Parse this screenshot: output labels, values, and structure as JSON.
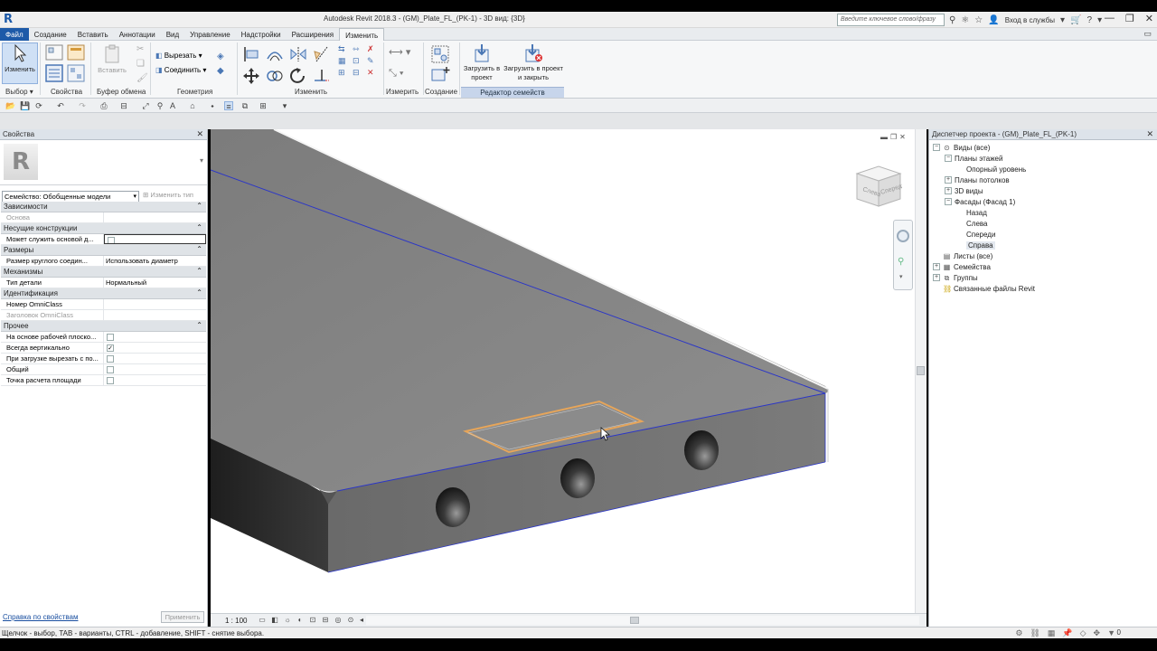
{
  "app": {
    "title": "Autodesk Revit 2018.3 -    (GM)_Plate_FL_(PK-1) - 3D вид: {3D}",
    "search_placeholder": "Введите ключевое слово/фразу",
    "sign_in": "Вход в службы"
  },
  "tabs": [
    {
      "label": "Файл"
    },
    {
      "label": "Создание"
    },
    {
      "label": "Вставить"
    },
    {
      "label": "Аннотации"
    },
    {
      "label": "Вид"
    },
    {
      "label": "Управление"
    },
    {
      "label": "Надстройки"
    },
    {
      "label": "Расширения"
    },
    {
      "label": "Изменить"
    }
  ],
  "ribbon": {
    "modify_label": "Изменить",
    "paste_label": "Вставить",
    "cut_label": "Вырезать",
    "join_label": "Соединить",
    "load_into_project": "Загрузить в проект",
    "load_into_project_close": "Загрузить в проект и закрыть",
    "panels": {
      "select": "Выбор",
      "properties": "Свойства",
      "clipboard": "Буфер обмена",
      "geometry": "Геометрия",
      "modify": "Изменить",
      "measure": "Измерить",
      "create": "Создание",
      "family_editor": "Редактор семейств"
    }
  },
  "properties": {
    "title": "Свойства",
    "family_selector": "Семейство: Обобщенные модели",
    "edit_type": "Изменить тип",
    "groups": [
      {
        "name": "Зависимости",
        "rows": [
          {
            "key": "Основа",
            "value": "",
            "disabled": true
          }
        ]
      },
      {
        "name": "Несущие конструкции",
        "rows": [
          {
            "key": "Может служить основой д...",
            "value": "",
            "checkbox": false,
            "focused": true
          }
        ]
      },
      {
        "name": "Размеры",
        "rows": [
          {
            "key": "Размер круглого соедин...",
            "value": "Использовать диаметр"
          }
        ]
      },
      {
        "name": "Механизмы",
        "rows": [
          {
            "key": "Тип детали",
            "value": "Нормальный"
          }
        ]
      },
      {
        "name": "Идентификация",
        "rows": [
          {
            "key": "Номер OmniClass",
            "value": ""
          },
          {
            "key": "Заголовок OmniClass",
            "value": "",
            "disabled": true
          }
        ]
      },
      {
        "name": "Прочее",
        "rows": [
          {
            "key": "На основе рабочей плоско...",
            "value": "",
            "checkbox": false
          },
          {
            "key": "Всегда вертикально",
            "value": "",
            "checkbox": true
          },
          {
            "key": "При загрузке вырезать с по...",
            "value": "",
            "checkbox": false
          },
          {
            "key": "Общий",
            "value": "",
            "checkbox": false
          },
          {
            "key": "Точка расчета площади",
            "value": "",
            "checkbox": false
          }
        ]
      }
    ],
    "help_link": "Справка по свойствам",
    "apply": "Применить"
  },
  "viewport": {
    "scale": "1 : 100",
    "viewcube_left": "Слева",
    "viewcube_front": "Спереди"
  },
  "browser": {
    "title": "Диспетчер проекта - (GM)_Plate_FL_(PK-1)",
    "nodes": [
      {
        "label": "Виды (все)",
        "level": 0,
        "exp": "−",
        "icon": "views"
      },
      {
        "label": "Планы этажей",
        "level": 1,
        "exp": "−"
      },
      {
        "label": "Опорный уровень",
        "level": 2,
        "exp": ""
      },
      {
        "label": "Планы потолков",
        "level": 1,
        "exp": "+"
      },
      {
        "label": "3D виды",
        "level": 1,
        "exp": "+"
      },
      {
        "label": "Фасады (Фасад 1)",
        "level": 1,
        "exp": "−"
      },
      {
        "label": "Назад",
        "level": 2,
        "exp": ""
      },
      {
        "label": "Слева",
        "level": 2,
        "exp": ""
      },
      {
        "label": "Спереди",
        "level": 2,
        "exp": ""
      },
      {
        "label": "Справа",
        "level": 2,
        "exp": "",
        "selected": true
      },
      {
        "label": "Листы (все)",
        "level": 0,
        "exp": "",
        "icon": "sheets"
      },
      {
        "label": "Семейства",
        "level": 0,
        "exp": "+",
        "icon": "families"
      },
      {
        "label": "Группы",
        "level": 0,
        "exp": "+",
        "icon": "groups"
      },
      {
        "label": "Связанные файлы Revit",
        "level": 0,
        "exp": "",
        "icon": "links"
      }
    ]
  },
  "status": {
    "text": "Щелчок - выбор, TAB - варианты, CTRL - добавление, SHIFT - снятие выбора.",
    "filter_count": "0"
  },
  "colors": {
    "file_tab": "#1d5aa8",
    "slab_top": "#8a8a8a",
    "slab_side": "#6f6f6f",
    "edge_highlight": "#2a35c8",
    "cut_outline": "#e6a55a"
  }
}
